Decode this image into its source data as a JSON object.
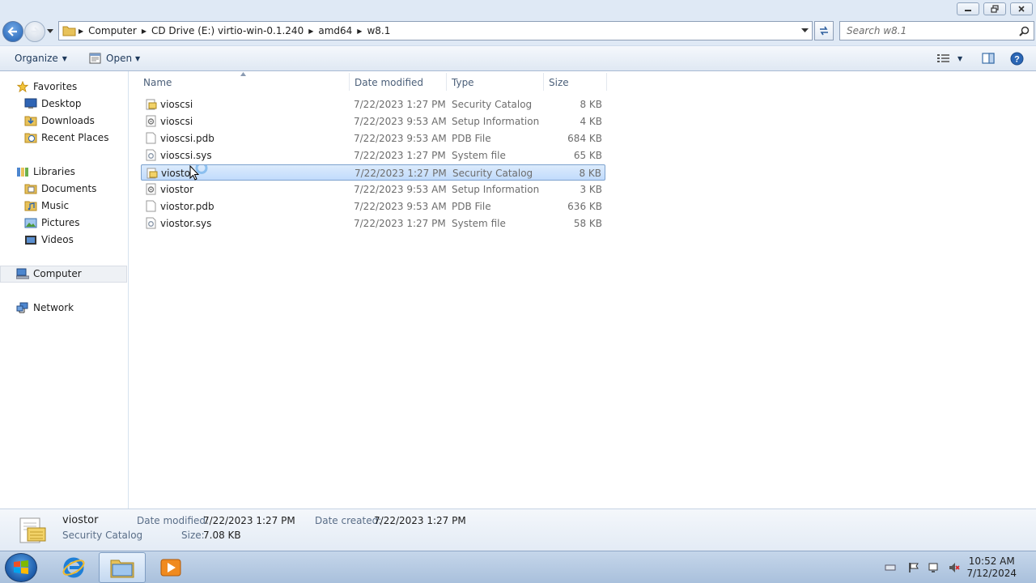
{
  "address": {
    "crumbs": [
      "Computer",
      "CD Drive (E:) virtio-win-0.1.240",
      "amd64",
      "w8.1"
    ]
  },
  "search": {
    "placeholder": "Search w8.1"
  },
  "toolbar": {
    "organize_label": "Organize",
    "open_label": "Open"
  },
  "nav": {
    "favorites": "Favorites",
    "desktop": "Desktop",
    "downloads": "Downloads",
    "recent_places": "Recent Places",
    "libraries": "Libraries",
    "documents": "Documents",
    "music": "Music",
    "pictures": "Pictures",
    "videos": "Videos",
    "computer": "Computer",
    "network": "Network"
  },
  "columns": {
    "name": "Name",
    "date": "Date modified",
    "type": "Type",
    "size": "Size"
  },
  "files": [
    {
      "name": "vioscsi",
      "date": "7/22/2023 1:27 PM",
      "type": "Security Catalog",
      "size": "8 KB",
      "icon": "catalog-icon"
    },
    {
      "name": "vioscsi",
      "date": "7/22/2023 9:53 AM",
      "type": "Setup Information",
      "size": "4 KB",
      "icon": "setup-info-icon"
    },
    {
      "name": "vioscsi.pdb",
      "date": "7/22/2023 9:53 AM",
      "type": "PDB File",
      "size": "684 KB",
      "icon": "blank-file-icon"
    },
    {
      "name": "vioscsi.sys",
      "date": "7/22/2023 1:27 PM",
      "type": "System file",
      "size": "65 KB",
      "icon": "system-file-icon"
    },
    {
      "name": "viostor",
      "date": "7/22/2023 1:27 PM",
      "type": "Security Catalog",
      "size": "8 KB",
      "icon": "catalog-icon"
    },
    {
      "name": "viostor",
      "date": "7/22/2023 9:53 AM",
      "type": "Setup Information",
      "size": "3 KB",
      "icon": "setup-info-icon"
    },
    {
      "name": "viostor.pdb",
      "date": "7/22/2023 9:53 AM",
      "type": "PDB File",
      "size": "636 KB",
      "icon": "blank-file-icon"
    },
    {
      "name": "viostor.sys",
      "date": "7/22/2023 1:27 PM",
      "type": "System file",
      "size": "58 KB",
      "icon": "system-file-icon"
    }
  ],
  "selected_index": 4,
  "details": {
    "name": "viostor",
    "type": "Security Catalog",
    "date_modified_label": "Date modified:",
    "date_modified": "7/22/2023 1:27 PM",
    "size_label": "Size:",
    "size": "7.08 KB",
    "date_created_label": "Date created:",
    "date_created": "7/22/2023 1:27 PM"
  },
  "clock": {
    "time": "10:52 AM",
    "date": "7/12/2024"
  },
  "colors": {
    "selection": "#c1dbfc",
    "accent": "#1f5fb1",
    "taskbar": "#a9c0dc"
  }
}
